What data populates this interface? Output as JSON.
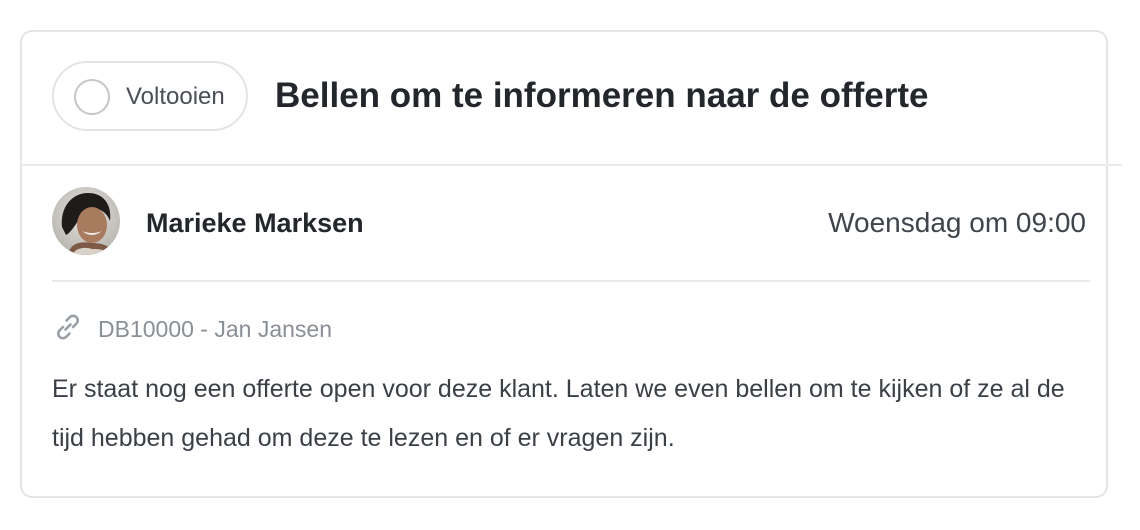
{
  "task": {
    "complete_label": "Voltooien",
    "title": "Bellen om te informeren naar de offerte",
    "author": "Marieke Marksen",
    "due": "Woensdag om 09:00",
    "related": "DB10000 - Jan Jansen",
    "description": "Er staat nog een offerte open voor deze klant. Laten we even bellen om te kijken of ze al de tijd hebben gehad om deze te lezen en of er vragen zijn."
  },
  "icons": {
    "complete": "circle-outline-icon",
    "related": "link-icon"
  },
  "colors": {
    "title": "#23262b",
    "muted": "#8a8f95",
    "border": "#e4e6e8"
  }
}
